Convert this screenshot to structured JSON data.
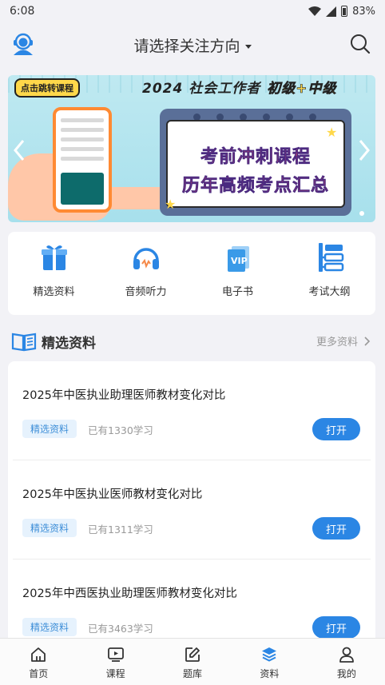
{
  "status_bar": {
    "time": "6:08",
    "battery": "83%"
  },
  "header": {
    "title": "请选择关注方向"
  },
  "banner": {
    "tag": "点击跳转课程",
    "headline": "2024 社会工作者",
    "headline_highlight": "初级+中级",
    "line1": "考前冲刺课程",
    "line2": "历年高频考点汇总"
  },
  "shortcuts": [
    {
      "label": "精选资料",
      "icon": "gift-box-icon"
    },
    {
      "label": "音频听力",
      "icon": "headphones-icon"
    },
    {
      "label": "电子书",
      "icon": "ebook-icon"
    },
    {
      "label": "考试大纲",
      "icon": "outline-icon"
    }
  ],
  "section": {
    "title": "精选资料",
    "more": "更多资料"
  },
  "items": [
    {
      "title": "2025年中医执业助理医师教材变化对比",
      "tag": "精选资料",
      "count": "已有1330学习",
      "button": "打开"
    },
    {
      "title": "2025年中医执业医师教材变化对比",
      "tag": "精选资料",
      "count": "已有1311学习",
      "button": "打开"
    },
    {
      "title": "2025年中西医执业助理医师教材变化对比",
      "tag": "精选资料",
      "count": "已有3463学习",
      "button": "打开"
    }
  ],
  "tabs": [
    {
      "label": "首页",
      "icon": "home-icon"
    },
    {
      "label": "课程",
      "icon": "video-icon"
    },
    {
      "label": "题库",
      "icon": "edit-icon"
    },
    {
      "label": "资料",
      "icon": "layers-icon",
      "active": true
    },
    {
      "label": "我的",
      "icon": "user-icon"
    }
  ],
  "colors": {
    "accent": "#2b86e4",
    "tag_bg": "#e6f2fd",
    "tag_text": "#3f8fd8"
  }
}
